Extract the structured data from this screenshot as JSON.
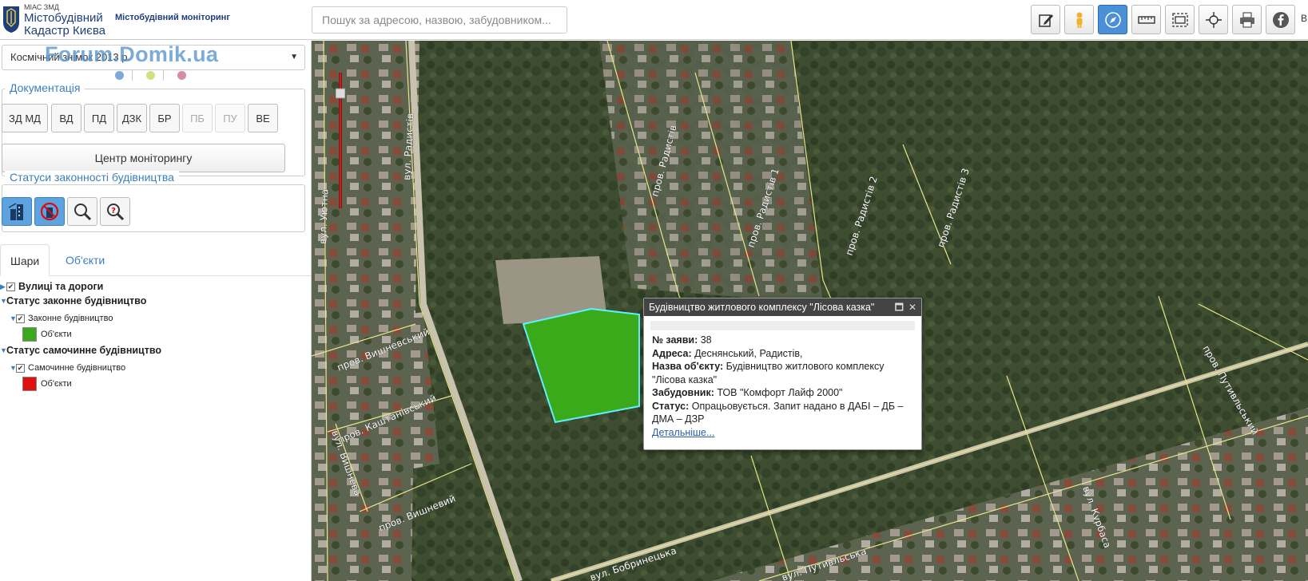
{
  "header": {
    "logo_small": "МІАС ЗМД",
    "logo_line1": "Містобудівний",
    "logo_line2": "Кадастр Києва",
    "logo_subtitle": "Містобудівний моніторинг",
    "search_placeholder": "Пошук за адресою, назвою, забудовником...",
    "toolbar": [
      {
        "name": "edit-icon",
        "active": false
      },
      {
        "name": "street-view-person-icon",
        "active": false
      },
      {
        "name": "compass-icon",
        "active": true
      },
      {
        "name": "ruler-icon",
        "active": false
      },
      {
        "name": "measure-area-icon",
        "active": false
      },
      {
        "name": "crosshair-icon",
        "active": false
      },
      {
        "name": "print-icon",
        "active": false
      },
      {
        "name": "facebook-icon",
        "active": false
      }
    ],
    "edge_label": "B"
  },
  "sidebar": {
    "watermark": "Forum.Domik.ua",
    "basemap_select": "Космічний знімок 2013 р.",
    "dots": [
      "#7fa8d8",
      "#d3e07e",
      "#d68ba0"
    ],
    "documentation_title": "Документація",
    "doc_buttons": [
      {
        "label": "ЗД МД",
        "enabled": true
      },
      {
        "label": "ВД",
        "enabled": true
      },
      {
        "label": "ПД",
        "enabled": true
      },
      {
        "label": "ДЗК",
        "enabled": true
      },
      {
        "label": "БР",
        "enabled": true
      },
      {
        "label": "ПБ",
        "enabled": false
      },
      {
        "label": "ПУ",
        "enabled": false
      },
      {
        "label": "ВЕ",
        "enabled": true
      }
    ],
    "center_button": "Центр моніторингу",
    "status_title": "Статуси законності будівництва",
    "tabs": [
      "Шари",
      "Об'єкти"
    ],
    "layers": {
      "roads": "Вулиці та дороги",
      "legal_status": "Статус законне будівництво",
      "legal_sub": "Законне будівництво",
      "legal_objects": "Об'єкти",
      "illegal_status": "Статус самочинне будівництво",
      "illegal_sub": "Самочинне будівництво",
      "illegal_objects": "Об'єкти",
      "legal_color": "#3aaa1a",
      "illegal_color": "#e01010"
    }
  },
  "map": {
    "streets": [
      "вул. Радистів",
      "вул. Уютна",
      "пров. Радистів",
      "пров. Радистів 1",
      "пров. Радистів 2",
      "пров. Радистів 3",
      "пров. Вишневський",
      "пров. Каштанівський",
      "вул. Вишнева",
      "пров. Вишневий",
      "вул. Бобринецька",
      "вул. Путивльська",
      "вул. Курбаса",
      "пров. Путивльський"
    ],
    "popup": {
      "title": "Будівництво житлового комплексу \"Лісова казка\"",
      "app_no_label": "№ заяви:",
      "app_no": "38",
      "address_label": "Адреса:",
      "address": "Деснянський, Радистів,",
      "name_label": "Назва об'єкту:",
      "name": "Будівництво житлового комплексу \"Лісова казка\"",
      "developer_label": "Забудовник:",
      "developer": "ТОВ \"Комфорт Лайф 2000\"",
      "status_label": "Статус:",
      "status": "Опрацьовується. Запит надано в ДАБІ – ДБ – ДМА – ДЗР",
      "more_link": "Детальніше..."
    }
  }
}
